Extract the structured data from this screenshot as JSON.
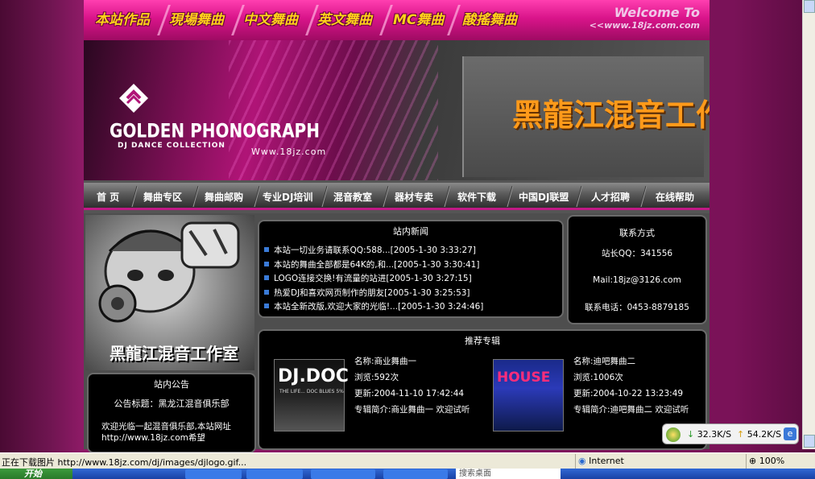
{
  "topbar": {
    "categories": [
      "本站作品",
      "現場舞曲",
      "中文舞曲",
      "英文舞曲",
      "MC舞曲",
      "酸搖舞曲"
    ],
    "welcome": "Welcome To",
    "welcome_url": "<<www.18jz.com.com"
  },
  "banner": {
    "brand": "GOLDEN PHONOGRAPH",
    "brand_sub": "DJ DANCE COLLECTION",
    "url": "Www.18jz.com",
    "studio": "黑龍江混音工作室"
  },
  "nav": {
    "items": [
      "首 页",
      "舞曲专区",
      "舞曲邮购",
      "专业DJ培训",
      "混音教室",
      "器材专卖",
      "软件下载",
      "中国DJ联盟",
      "人才招聘",
      "在线帮助"
    ]
  },
  "left_image_caption": "黑龍江混音工作室",
  "notice": {
    "title": "站内公告",
    "headline": "公告标题：黑龙江混音俱乐部",
    "body": "欢迎光临一起混音俱乐部,本站网址http://www.18jz.com希望"
  },
  "news": {
    "title": "站内新闻",
    "items": [
      "本站一切业务请联系QQ:588...[2005-1-30 3:33:27]",
      "本站的舞曲全部都是64K的,和...[2005-1-30 3:30:41]",
      "LOGO连接交换!有流量的站进[2005-1-30 3:27:15]",
      "热爱DJ和喜欢网页制作的朋友[2005-1-30 3:25:53]",
      "本站全新改版,欢迎大家的光临!...[2005-1-30 3:24:46]"
    ]
  },
  "contact": {
    "title": "联系方式",
    "qq": "站长QQ：341556",
    "mail": "Mail:18jz@3126.com",
    "phone": "联系电话：0453-8879185"
  },
  "albums": {
    "title": "推荐专辑",
    "cover1_title": "DJ.DOC",
    "cover1_sub": "THE LIFE... DOC BLUES 5%",
    "cover2_title": "HOUSE",
    "items": [
      {
        "name": "名称:商业舞曲一",
        "views": "浏览:592次",
        "updated": "更新:2004-11-10 17:42:44",
        "intro": "专辑简介:商业舞曲一 欢迎试听"
      },
      {
        "name": "名称:迪吧舞曲二",
        "views": "浏览:1006次",
        "updated": "更新:2004-10-22 13:23:49",
        "intro": "专辑简介:迪吧舞曲二 欢迎试听"
      }
    ]
  },
  "speed": {
    "down": "32.3K/S",
    "up": "54.2K/S"
  },
  "statusbar": {
    "text": "正在下载图片 http://www.18jz.com/dj/images/djlogo.gif...",
    "zone": "Internet",
    "zoom": "100%"
  },
  "taskbar": {
    "start": "开始",
    "search": "搜索桌面"
  }
}
